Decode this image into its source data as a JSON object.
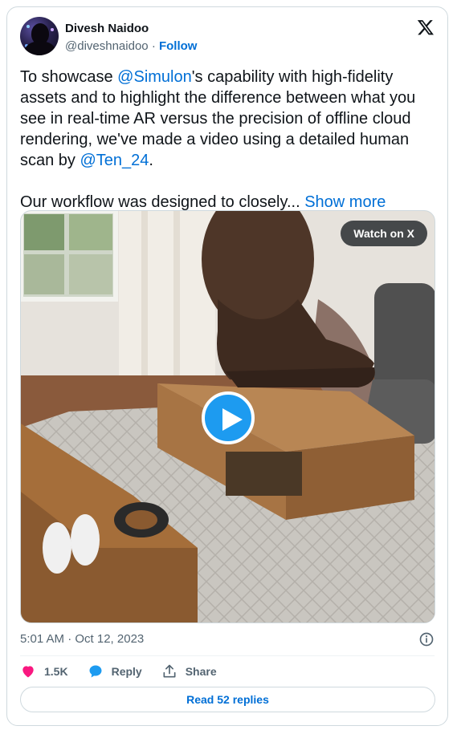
{
  "author": {
    "name": "Divesh Naidoo",
    "handle": "@diveshnaidoo",
    "follow_label": "Follow"
  },
  "tweet": {
    "text_before_mention1": "To showcase ",
    "mention1": "@Simulon",
    "text_after_mention1": "'s capability with high-fidelity assets and to highlight the difference between what you see in real-time AR versus the precision of offline cloud rendering, we've made a video using a detailed human scan by ",
    "mention2": "@Ten_24",
    "text_after_mention2": ".",
    "second_paragraph": "Our workflow was designed to closely... ",
    "show_more_label": "Show more"
  },
  "media": {
    "watch_label": "Watch on X",
    "icons": [
      "play-icon"
    ]
  },
  "meta": {
    "timestamp": "5:01 AM · Oct 12, 2023"
  },
  "actions": {
    "like_count": "1.5K",
    "reply_label": "Reply",
    "share_label": "Share",
    "read_replies_label": "Read 52 replies"
  },
  "colors": {
    "link": "#006fd6",
    "like": "#f91880",
    "reply": "#1d9bf0",
    "play": "#1d9bf0",
    "secondary_text": "#536471",
    "border": "#cfd9de"
  }
}
